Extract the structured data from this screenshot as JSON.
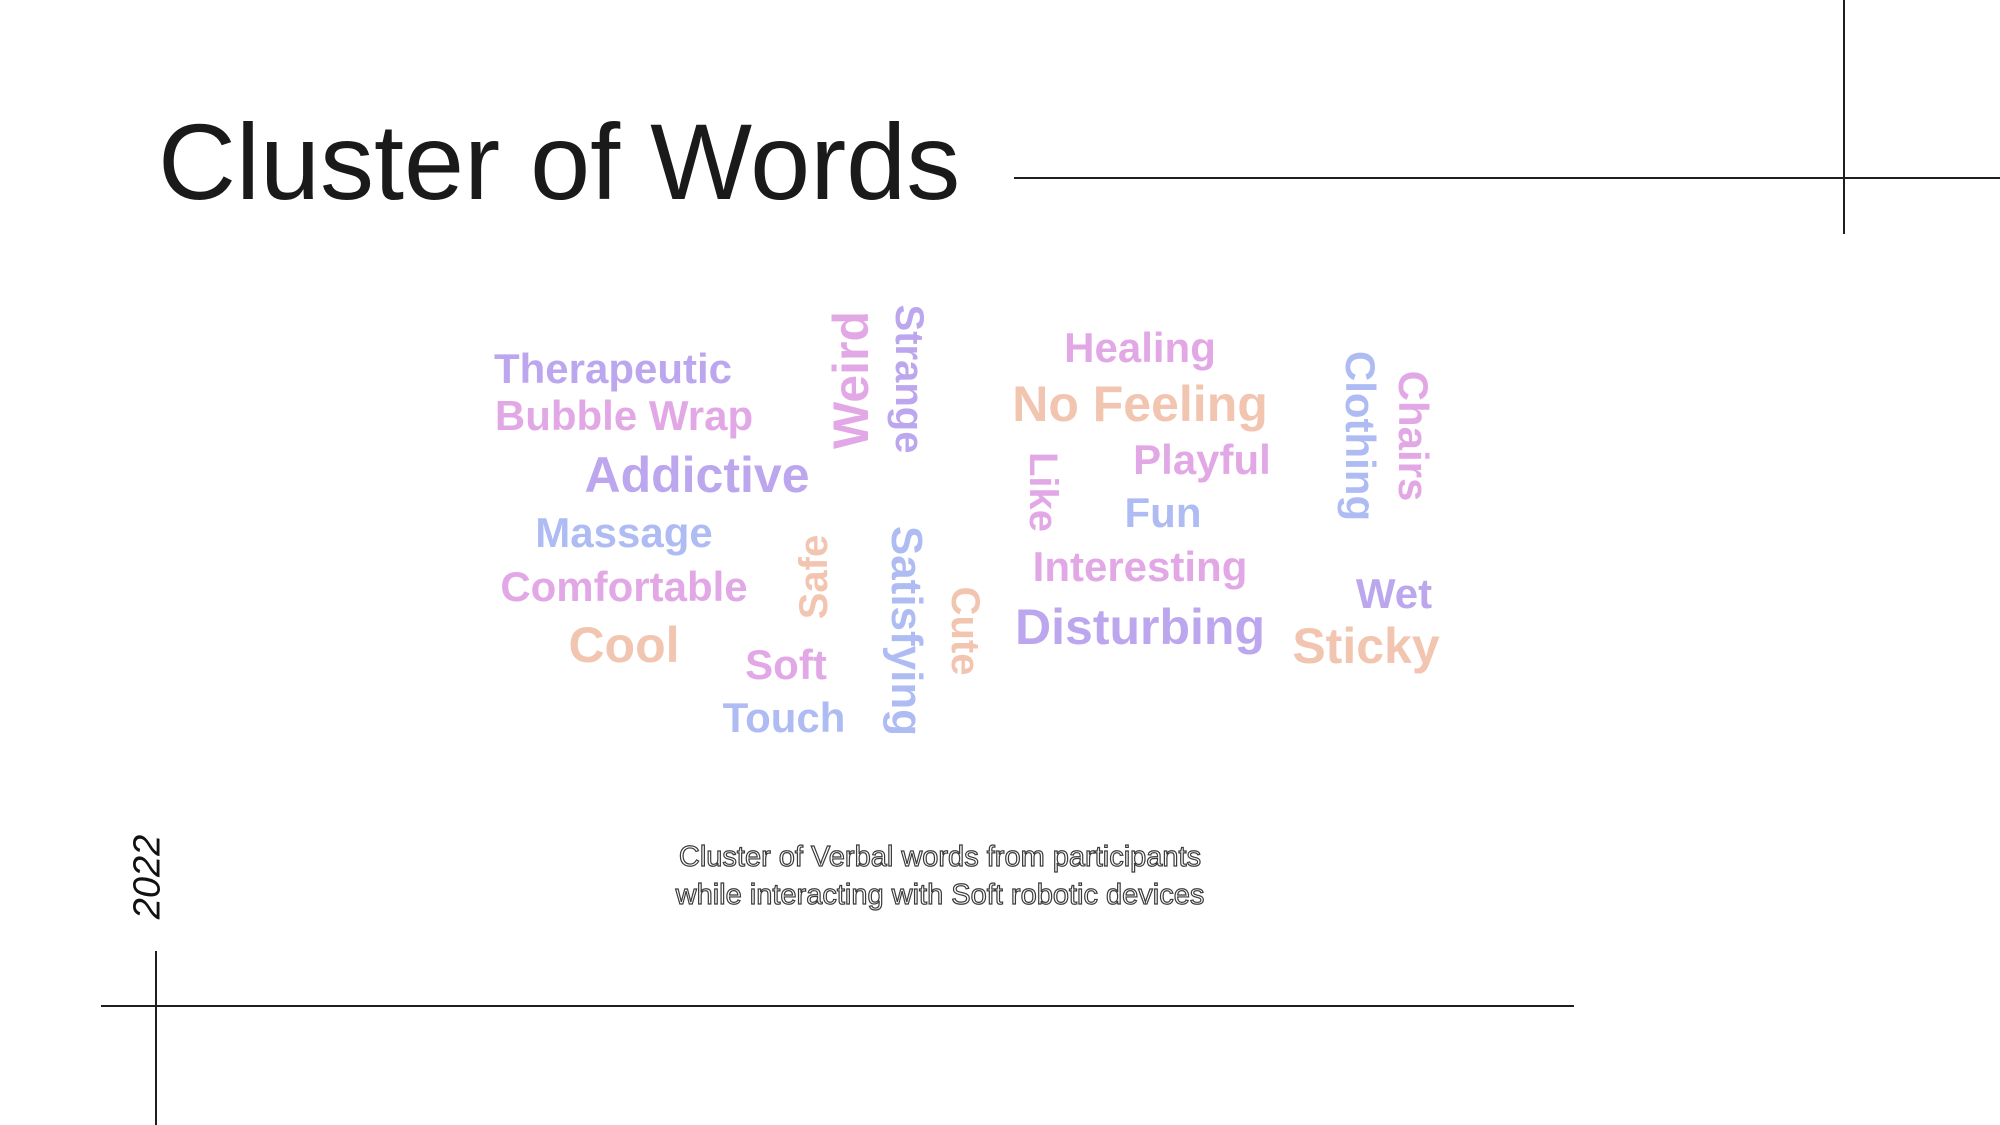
{
  "slide": {
    "title": "Cluster of Words",
    "year": "2022",
    "caption_line1": "Cluster of Verbal words from participants",
    "caption_line2": "while interacting with Soft robotic devices"
  },
  "colors": {
    "purple": "#bca7ef",
    "pink": "#e2a8e6",
    "blue": "#aebcf3",
    "peach": "#f2c5b1"
  },
  "word_cloud": {
    "words": [
      {
        "text": "Therapeutic",
        "color": "purple"
      },
      {
        "text": "Bubble Wrap",
        "color": "pink"
      },
      {
        "text": "Addictive",
        "color": "purple"
      },
      {
        "text": "Massage",
        "color": "blue"
      },
      {
        "text": "Comfortable",
        "color": "pink"
      },
      {
        "text": "Cool",
        "color": "peach"
      },
      {
        "text": "Soft",
        "color": "pink"
      },
      {
        "text": "Touch",
        "color": "blue"
      },
      {
        "text": "Safe",
        "color": "peach"
      },
      {
        "text": "Weird",
        "color": "pink"
      },
      {
        "text": "Strange",
        "color": "purple"
      },
      {
        "text": "Satisfying",
        "color": "blue"
      },
      {
        "text": "Cute",
        "color": "peach"
      },
      {
        "text": "Healing",
        "color": "pink"
      },
      {
        "text": "No Feeling",
        "color": "peach"
      },
      {
        "text": "Playful",
        "color": "pink"
      },
      {
        "text": "Like",
        "color": "pink"
      },
      {
        "text": "Fun",
        "color": "blue"
      },
      {
        "text": "Interesting",
        "color": "pink"
      },
      {
        "text": "Disturbing",
        "color": "purple"
      },
      {
        "text": "Clothing",
        "color": "blue"
      },
      {
        "text": "Chairs",
        "color": "pink"
      },
      {
        "text": "Wet",
        "color": "purple"
      },
      {
        "text": "Sticky",
        "color": "peach"
      }
    ]
  }
}
